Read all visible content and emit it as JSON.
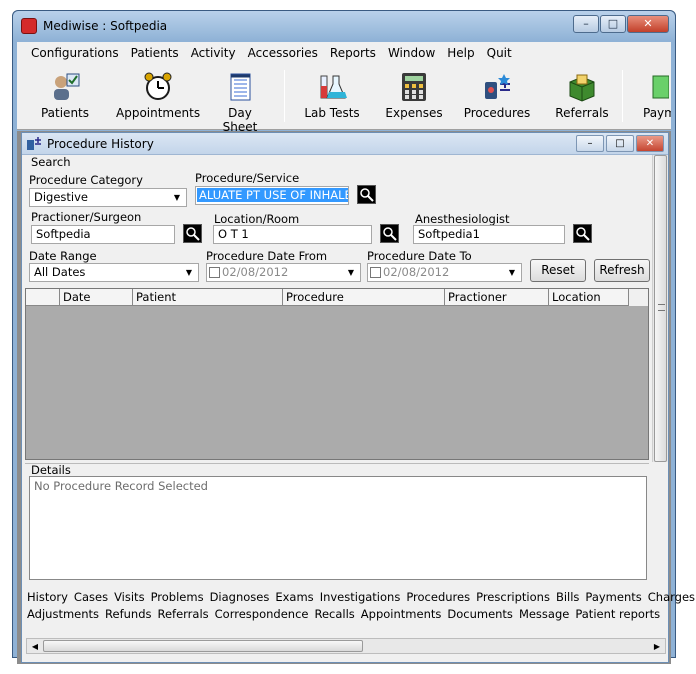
{
  "window": {
    "title": "Mediwise : Softpedia"
  },
  "menubar": [
    "Configurations",
    "Patients",
    "Activity",
    "Accessories",
    "Reports",
    "Window",
    "Help",
    "Quit"
  ],
  "toolbar": [
    {
      "label": "Patients",
      "icon": "patients-icon"
    },
    {
      "label": "Appointments",
      "icon": "alarm-clock-icon"
    },
    {
      "label": "Day Sheet",
      "icon": "notepad-icon"
    },
    {
      "label": "Lab Tests",
      "icon": "lab-flasks-icon"
    },
    {
      "label": "Expenses",
      "icon": "calculator-icon"
    },
    {
      "label": "Procedures",
      "icon": "procedures-icon"
    },
    {
      "label": "Referrals",
      "icon": "referral-box-icon"
    },
    {
      "label": "Paym",
      "icon": "payment-icon"
    }
  ],
  "child_window": {
    "title": "Procedure History"
  },
  "search": {
    "group_label": "Search",
    "category_label": "Procedure Category",
    "category_value": "Digestive",
    "service_label": "Procedure/Service",
    "service_value": "ALUATE PT USE OF INHALER",
    "surgeon_label": "Practioner/Surgeon",
    "surgeon_value": "Softpedia",
    "location_label": "Location/Room",
    "location_value": "O T 1",
    "anesthesiologist_label": "Anesthesiologist",
    "anesthesiologist_value": "Softpedia1",
    "date_range_label": "Date Range",
    "date_range_value": "All Dates",
    "date_from_label": "Procedure Date From",
    "date_from_value": "02/08/2012",
    "date_to_label": "Procedure Date To",
    "date_to_value": "02/08/2012",
    "reset_label": "Reset",
    "refresh_label": "Refresh"
  },
  "grid": {
    "columns": [
      "Date",
      "Patient",
      "Procedure",
      "Practioner",
      "Location"
    ],
    "rows": []
  },
  "details": {
    "label": "Details",
    "text": "No Procedure Record Selected"
  },
  "tabs": {
    "row1": [
      "History",
      "Cases",
      "Visits",
      "Problems",
      "Diagnoses",
      "Exams",
      "Investigations",
      "Procedures",
      "Prescriptions",
      "Bills",
      "Payments",
      "Charges"
    ],
    "row2": [
      "Adjustments",
      "Refunds",
      "Referrals",
      "Correspondence",
      "Recalls",
      "Appointments",
      "Documents",
      "Message",
      "Patient reports"
    ]
  },
  "colors": {
    "title_bar": "#8fb2d6",
    "selection": "#3399ff",
    "grid_background": "#ababab"
  }
}
